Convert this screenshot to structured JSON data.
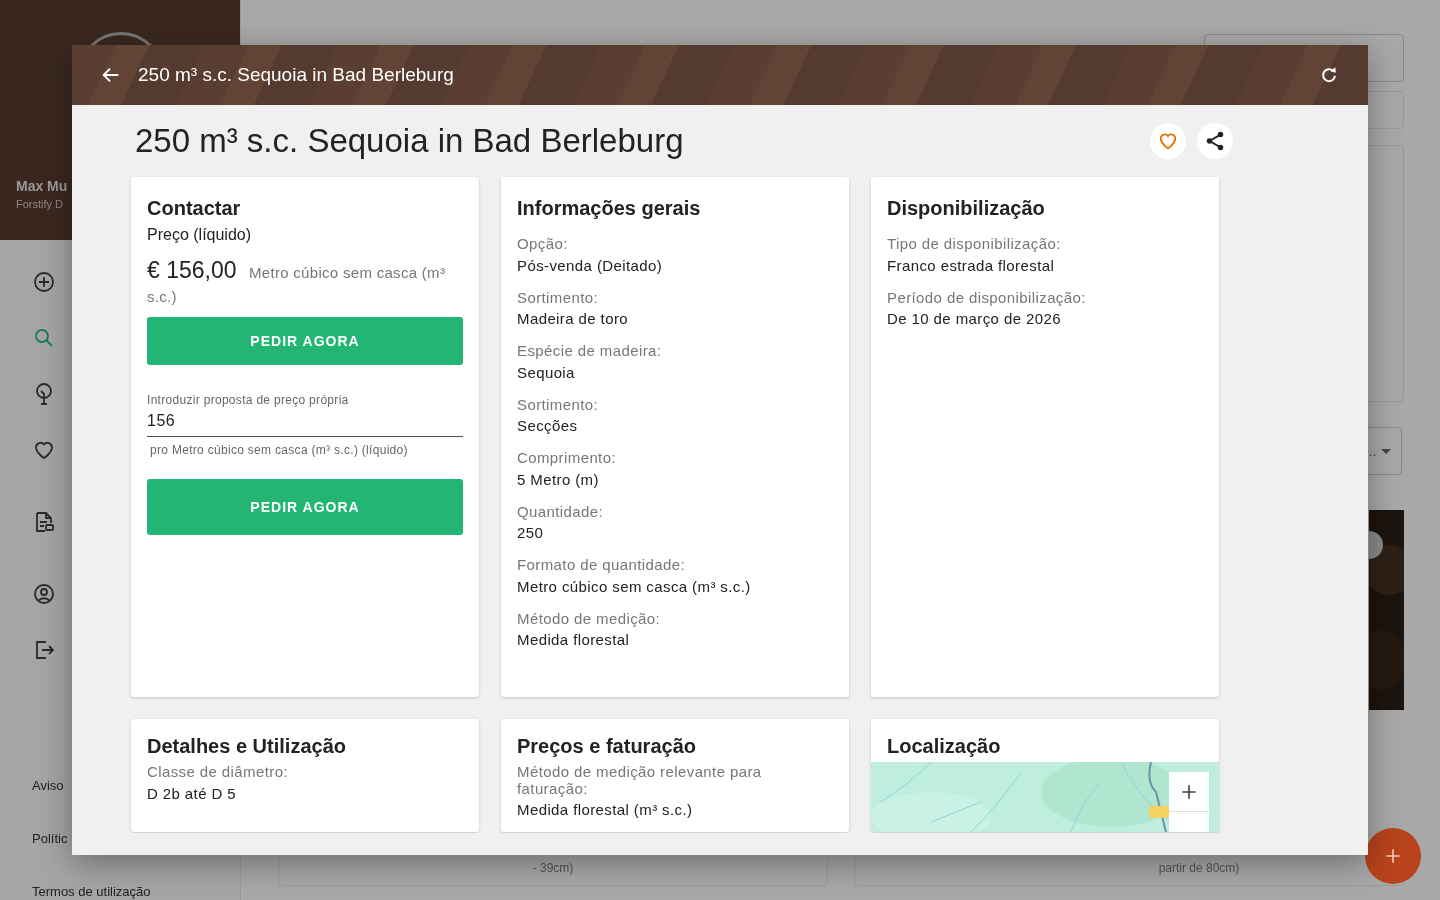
{
  "background": {
    "sidebar": {
      "user_name": "Max Mu",
      "user_subtitle": "Forstify D",
      "nav": [
        {
          "selected": false
        },
        {
          "selected": true
        },
        {
          "selected": false
        },
        {
          "selected": false
        },
        {
          "selected": false
        },
        {
          "selected": false
        },
        {
          "selected": false
        }
      ],
      "footer_links": [
        "Aviso",
        "Polític",
        "Termos de utilização"
      ]
    },
    "main": {
      "dropdown_text": "…",
      "card_texts": [
        "- 39cm)",
        "partir de 80cm)"
      ]
    }
  },
  "dialog": {
    "title": "250 m³ s.c. Sequoia in Bad Berleburg",
    "heading": "250 m³ s.c. Sequoia in Bad Berleburg",
    "favorited": false,
    "contact": {
      "title": "Contactar",
      "price_label": "Preço (líquido)",
      "price": "€ 156,00",
      "unit": "Metro cúbico sem casca (m³ s.c.)",
      "order_button": "PEDIR AGORA",
      "offer_field": {
        "label": "Introduzir proposta de preço própria",
        "value": "156",
        "hint": "pro Metro cúbico sem casca (m³ s.c.) (líquido)"
      },
      "offer_button": "PEDIR AGORA"
    },
    "cards": [
      {
        "kind": "fields",
        "title": "Informações gerais",
        "fields": [
          {
            "label": "Opção:",
            "value": "Pós-venda (Deitado)"
          },
          {
            "label": "Sortimento:",
            "value": "Madeira de toro"
          },
          {
            "label": "Espécie de madeira:",
            "value": "Sequoia"
          },
          {
            "label": "Sortimento:",
            "value": "Secções"
          },
          {
            "label": "Comprimento:",
            "value": "5 Metro (m)"
          },
          {
            "label": "Quantidade:",
            "value": "250"
          },
          {
            "label": "Formato de quantidade:",
            "value": "Metro cúbico sem casca (m³ s.c.)"
          },
          {
            "label": "Método de medição:",
            "value": "Medida florestal"
          }
        ]
      },
      {
        "kind": "fields",
        "title": "Disponibilização",
        "fields": [
          {
            "label": "Tipo de disponibilização:",
            "value": "Franco estrada florestal"
          },
          {
            "label": "Período de disponibilização:",
            "value": "De 10 de março de 2026"
          }
        ]
      },
      {
        "kind": "fields",
        "title": "Detalhes e Utilização",
        "fields": [
          {
            "label": "Classe de diâmetro:",
            "value": "D 2b até D 5"
          }
        ]
      },
      {
        "kind": "fields",
        "title": "Preços e faturação",
        "fields": [
          {
            "label": "Método de medição relevante para faturação:",
            "value": "Medida florestal (m³ s.c.)"
          }
        ]
      },
      {
        "kind": "map",
        "title": "Localização"
      }
    ]
  }
}
